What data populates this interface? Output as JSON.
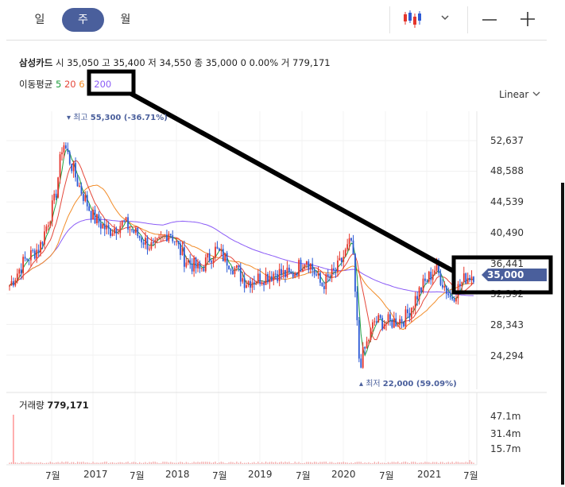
{
  "period_tabs": [
    {
      "label": "일",
      "active": false
    },
    {
      "label": "주",
      "active": true
    },
    {
      "label": "월",
      "active": false
    }
  ],
  "toolbar": {
    "chart_type_icon": "candlestick-icon",
    "dropdown_icon": "chevron-down-icon",
    "zoom_out_icon": "minus-icon",
    "zoom_in_icon": "plus-icon"
  },
  "stock": {
    "name": "삼성카드",
    "open_label": "시",
    "open": "35,050",
    "high_label": "고",
    "high": "35,400",
    "low_label": "저",
    "low": "34,550",
    "close_label": "종",
    "close": "35,000",
    "change": "0",
    "change_pct": "0.00%",
    "volume_label": "거",
    "volume": "779,171"
  },
  "moving_average": {
    "label": "이동평균",
    "periods": [
      {
        "value": "5",
        "color": "#1e9e3e"
      },
      {
        "value": "20",
        "color": "#e5483b"
      },
      {
        "value": "6",
        "color": "#f28c28"
      },
      {
        "value": "200",
        "color": "#8b5cf6"
      }
    ]
  },
  "scale": {
    "label": "Linear"
  },
  "colors": {
    "up": "#e5352b",
    "down": "#2d5bd6",
    "accent": "#4a5f9c",
    "annotation": "#000000"
  },
  "chart_data": {
    "type": "candlestick",
    "price_axis": {
      "ticks": [
        "52,637",
        "48,588",
        "44,539",
        "40,490",
        "36,441",
        "32,392",
        "28,343",
        "24,294"
      ],
      "values": [
        52637,
        48588,
        44539,
        40490,
        36441,
        32392,
        28343,
        24294
      ]
    },
    "current_price_label": "35,000",
    "high_marker": {
      "label": "최고",
      "value": "55,300 (-36.71%)"
    },
    "low_marker": {
      "label": "최저",
      "value": "22,000 (59.09%)"
    },
    "x_axis_labels": [
      "7월",
      "2017",
      "7월",
      "2018",
      "7월",
      "2019",
      "7월",
      "2020",
      "7월",
      "2021",
      "7월"
    ],
    "volume_panel": {
      "label": "거래량",
      "value": "779,171",
      "ticks": [
        "47.1m",
        "31.4m",
        "15.7m"
      ]
    },
    "price_series_approx": [
      {
        "t": "2016-05",
        "close": 33500
      },
      {
        "t": "2016-07",
        "close": 36800
      },
      {
        "t": "2016-09",
        "close": 38600
      },
      {
        "t": "2016-11",
        "close": 45000
      },
      {
        "t": "2016-12",
        "close": 52600
      },
      {
        "t": "2017-02",
        "close": 47000
      },
      {
        "t": "2017-04",
        "close": 42500
      },
      {
        "t": "2017-06",
        "close": 40700
      },
      {
        "t": "2017-08",
        "close": 41800
      },
      {
        "t": "2017-10",
        "close": 40000
      },
      {
        "t": "2017-12",
        "close": 38300
      },
      {
        "t": "2018-02",
        "close": 40800
      },
      {
        "t": "2018-04",
        "close": 37000
      },
      {
        "t": "2018-06",
        "close": 35500
      },
      {
        "t": "2018-08",
        "close": 38200
      },
      {
        "t": "2018-10",
        "close": 36500
      },
      {
        "t": "2018-12",
        "close": 34000
      },
      {
        "t": "2019-02",
        "close": 34500
      },
      {
        "t": "2019-04",
        "close": 35200
      },
      {
        "t": "2019-06",
        "close": 34800
      },
      {
        "t": "2019-08",
        "close": 37200
      },
      {
        "t": "2019-10",
        "close": 33500
      },
      {
        "t": "2019-12",
        "close": 35500
      },
      {
        "t": "2020-02",
        "close": 39500
      },
      {
        "t": "2020-03",
        "close": 23000
      },
      {
        "t": "2020-05",
        "close": 28800
      },
      {
        "t": "2020-07",
        "close": 28600
      },
      {
        "t": "2020-09",
        "close": 29200
      },
      {
        "t": "2020-11",
        "close": 33000
      },
      {
        "t": "2021-01",
        "close": 35800
      },
      {
        "t": "2021-03",
        "close": 31800
      },
      {
        "t": "2021-05",
        "close": 34600
      },
      {
        "t": "2021-06",
        "close": 35000
      }
    ]
  }
}
